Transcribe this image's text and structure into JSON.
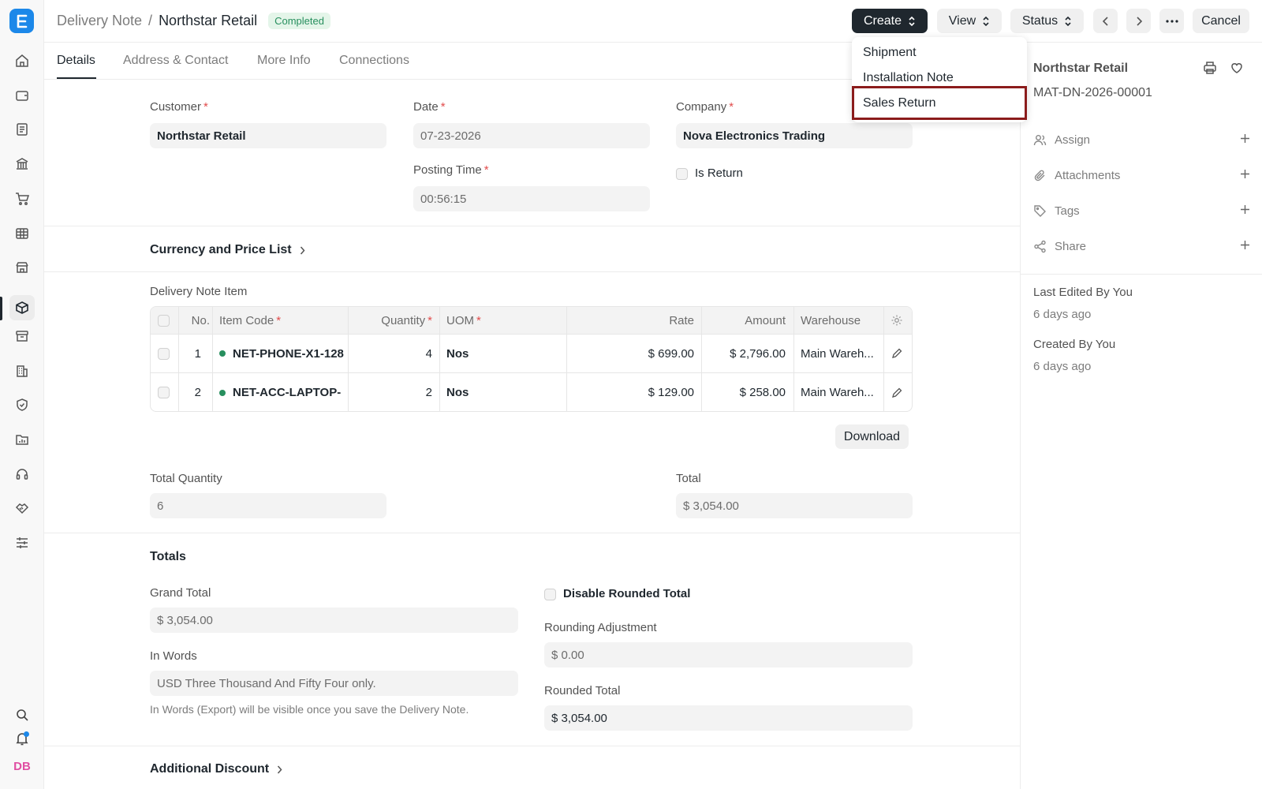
{
  "header": {
    "breadcrumb_parent": "Delivery Note",
    "breadcrumb_separator": "/",
    "title": "Northstar Retail",
    "status_badge": "Completed",
    "create_label": "Create",
    "view_label": "View",
    "status_label": "Status",
    "cancel_label": "Cancel"
  },
  "create_menu": {
    "items": [
      "Shipment",
      "Installation Note",
      "Sales Return"
    ],
    "highlighted": "Sales Return"
  },
  "tabs": [
    "Details",
    "Address & Contact",
    "More Info",
    "Connections"
  ],
  "form": {
    "customer_label": "Customer",
    "customer_value": "Northstar Retail",
    "date_label": "Date",
    "date_value": "07-23-2026",
    "posting_time_label": "Posting Time",
    "posting_time_value": "00:56:15",
    "company_label": "Company",
    "company_value": "Nova Electronics Trading",
    "is_return_label": "Is Return",
    "is_return_checked": false,
    "currency_section": "Currency and Price List",
    "items_label": "Delivery Note Item",
    "download_label": "Download",
    "total_qty_label": "Total Quantity",
    "total_qty_value": "6",
    "total_label": "Total",
    "total_value": "$ 3,054.00",
    "totals_section": "Totals",
    "grand_total_label": "Grand Total",
    "grand_total_value": "$ 3,054.00",
    "in_words_label": "In Words",
    "in_words_value": "USD Three Thousand And Fifty Four only.",
    "in_words_hint": "In Words (Export) will be visible once you save the Delivery Note.",
    "disable_rounded_label": "Disable Rounded Total",
    "rounding_adj_label": "Rounding Adjustment",
    "rounding_adj_value": "$ 0.00",
    "rounded_total_label": "Rounded Total",
    "rounded_total_value": "$ 3,054.00",
    "additional_discount_section": "Additional Discount"
  },
  "items_table": {
    "columns": [
      "No.",
      "Item Code",
      "Quantity",
      "UOM",
      "Rate",
      "Amount",
      "Warehouse"
    ],
    "rows": [
      {
        "no": "1",
        "item_code": "NET-PHONE-X1-128",
        "quantity": "4",
        "uom": "Nos",
        "rate": "$ 699.00",
        "amount": "$ 2,796.00",
        "warehouse": "Main Wareh..."
      },
      {
        "no": "2",
        "item_code": "NET-ACC-LAPTOP-",
        "quantity": "2",
        "uom": "Nos",
        "rate": "$ 129.00",
        "amount": "$ 258.00",
        "warehouse": "Main Wareh..."
      }
    ]
  },
  "sidebar": {
    "title": "Northstar Retail",
    "doc_id": "MAT-DN-2026-00001",
    "actions": [
      "Assign",
      "Attachments",
      "Tags",
      "Share"
    ],
    "last_edited_label": "Last Edited By You",
    "last_edited_time": "6 days ago",
    "created_label": "Created By You",
    "created_time": "6 days ago"
  },
  "user": {
    "initials": "DB"
  },
  "colors": {
    "accent": "#1c88e9",
    "dark": "#1f272e",
    "success": "#278f5e",
    "required": "#e24c4c",
    "highlight": "#8b1c1c"
  }
}
